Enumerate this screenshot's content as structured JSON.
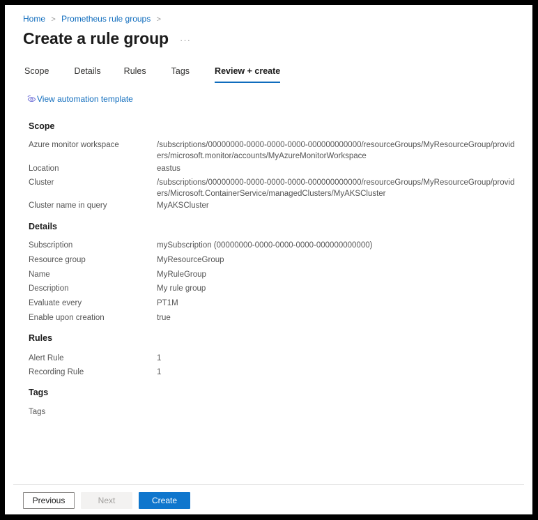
{
  "breadcrumb": {
    "items": [
      {
        "label": "Home"
      },
      {
        "label": "Prometheus rule groups"
      }
    ],
    "separator": ">"
  },
  "header": {
    "title": "Create a rule group",
    "more_menu": "···"
  },
  "tabs": [
    {
      "label": "Scope",
      "active": false
    },
    {
      "label": "Details",
      "active": false
    },
    {
      "label": "Rules",
      "active": false
    },
    {
      "label": "Tags",
      "active": false
    },
    {
      "label": "Review + create",
      "active": true
    }
  ],
  "automation_template": {
    "label": "View automation template",
    "icon": "view-eye-icon"
  },
  "sections": {
    "scope": {
      "heading": "Scope",
      "rows": [
        {
          "label": "Azure monitor workspace",
          "value": "/subscriptions/00000000-0000-0000-0000-000000000000/resourceGroups/MyResourceGroup/providers/microsoft.monitor/accounts/MyAzureMonitorWorkspace"
        },
        {
          "label": "Location",
          "value": "eastus"
        },
        {
          "label": "Cluster",
          "value": "/subscriptions/00000000-0000-0000-0000-000000000000/resourceGroups/MyResourceGroup/providers/Microsoft.ContainerService/managedClusters/MyAKSCluster"
        },
        {
          "label": "Cluster name in query",
          "value": "MyAKSCluster"
        }
      ]
    },
    "details": {
      "heading": "Details",
      "rows": [
        {
          "label": "Subscription",
          "value": "mySubscription (00000000-0000-0000-0000-000000000000)"
        },
        {
          "label": "Resource group",
          "value": "MyResourceGroup"
        },
        {
          "label": "Name",
          "value": "MyRuleGroup"
        },
        {
          "label": "Description",
          "value": "My rule group"
        },
        {
          "label": "Evaluate every",
          "value": "PT1M"
        },
        {
          "label": "Enable upon creation",
          "value": "true"
        }
      ]
    },
    "rules": {
      "heading": "Rules",
      "rows": [
        {
          "label": "Alert Rule",
          "value": "1"
        },
        {
          "label": "Recording Rule",
          "value": "1"
        }
      ]
    },
    "tags": {
      "heading": "Tags",
      "rows": [
        {
          "label": "Tags",
          "value": ""
        }
      ]
    }
  },
  "footer": {
    "previous_label": "Previous",
    "next_label": "Next",
    "create_label": "Create"
  },
  "colors": {
    "accent": "#0f6cbd",
    "primary_button": "#0f76cd",
    "link": "#0f6cbd",
    "text": "#1b1b1b",
    "muted_text": "#555555",
    "frame": "#000000"
  }
}
